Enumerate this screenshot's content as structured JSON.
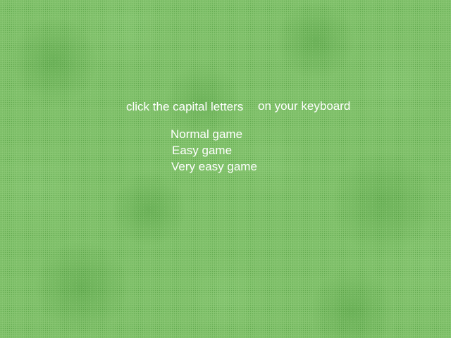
{
  "instructions": {
    "part1": "click the capital letters",
    "part2": "on your keyboard"
  },
  "menu": {
    "options": [
      {
        "label": "Normal game"
      },
      {
        "label": "Easy game"
      },
      {
        "label": "Very easy game"
      }
    ]
  },
  "colors": {
    "background": "#85c46f",
    "text": "#ffffff"
  }
}
